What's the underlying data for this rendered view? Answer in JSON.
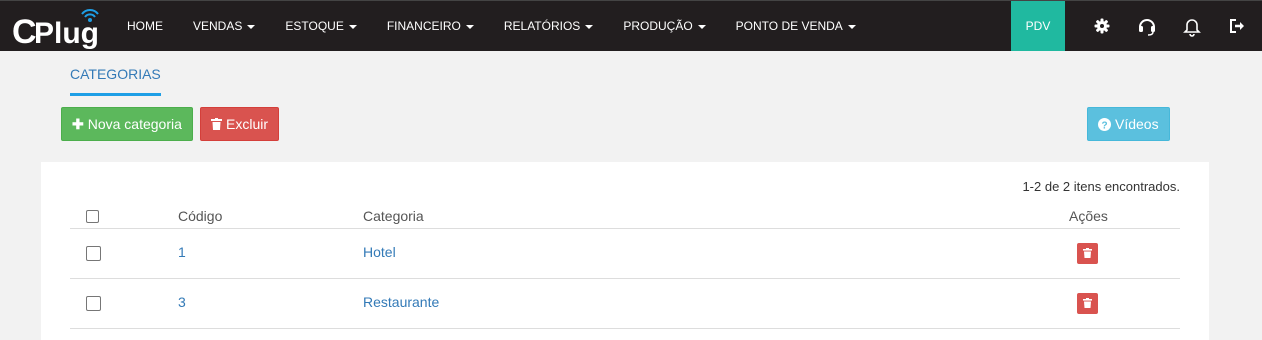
{
  "brand": {
    "name": "CPlug"
  },
  "nav": {
    "items": [
      {
        "label": "HOME",
        "dropdown": false
      },
      {
        "label": "VENDAS",
        "dropdown": true
      },
      {
        "label": "ESTOQUE",
        "dropdown": true
      },
      {
        "label": "FINANCEIRO",
        "dropdown": true
      },
      {
        "label": "RELATÓRIOS",
        "dropdown": true
      },
      {
        "label": "PRODUÇÃO",
        "dropdown": true
      },
      {
        "label": "PONTO DE VENDA",
        "dropdown": true
      }
    ],
    "pdv_label": "PDV",
    "icons": [
      "gear-icon",
      "headset-icon",
      "bell-icon",
      "logout-icon"
    ]
  },
  "tabs": {
    "active": "CATEGORIAS"
  },
  "toolbar": {
    "new_label": "Nova categoria",
    "delete_label": "Excluir",
    "videos_label": "Vídeos"
  },
  "result_count": "1-2 de 2 itens encontrados.",
  "table": {
    "headers": {
      "code": "Código",
      "category": "Categoria",
      "actions": "Ações"
    },
    "rows": [
      {
        "code": "1",
        "category": "Hotel"
      },
      {
        "code": "3",
        "category": "Restaurante"
      }
    ]
  },
  "colors": {
    "topbar": "#221e1f",
    "pdv": "#20b9a0",
    "success": "#5cb85c",
    "danger": "#d9534f",
    "info": "#5bc0de",
    "link": "#337ab7",
    "tab_underline": "#1e9fe6"
  }
}
